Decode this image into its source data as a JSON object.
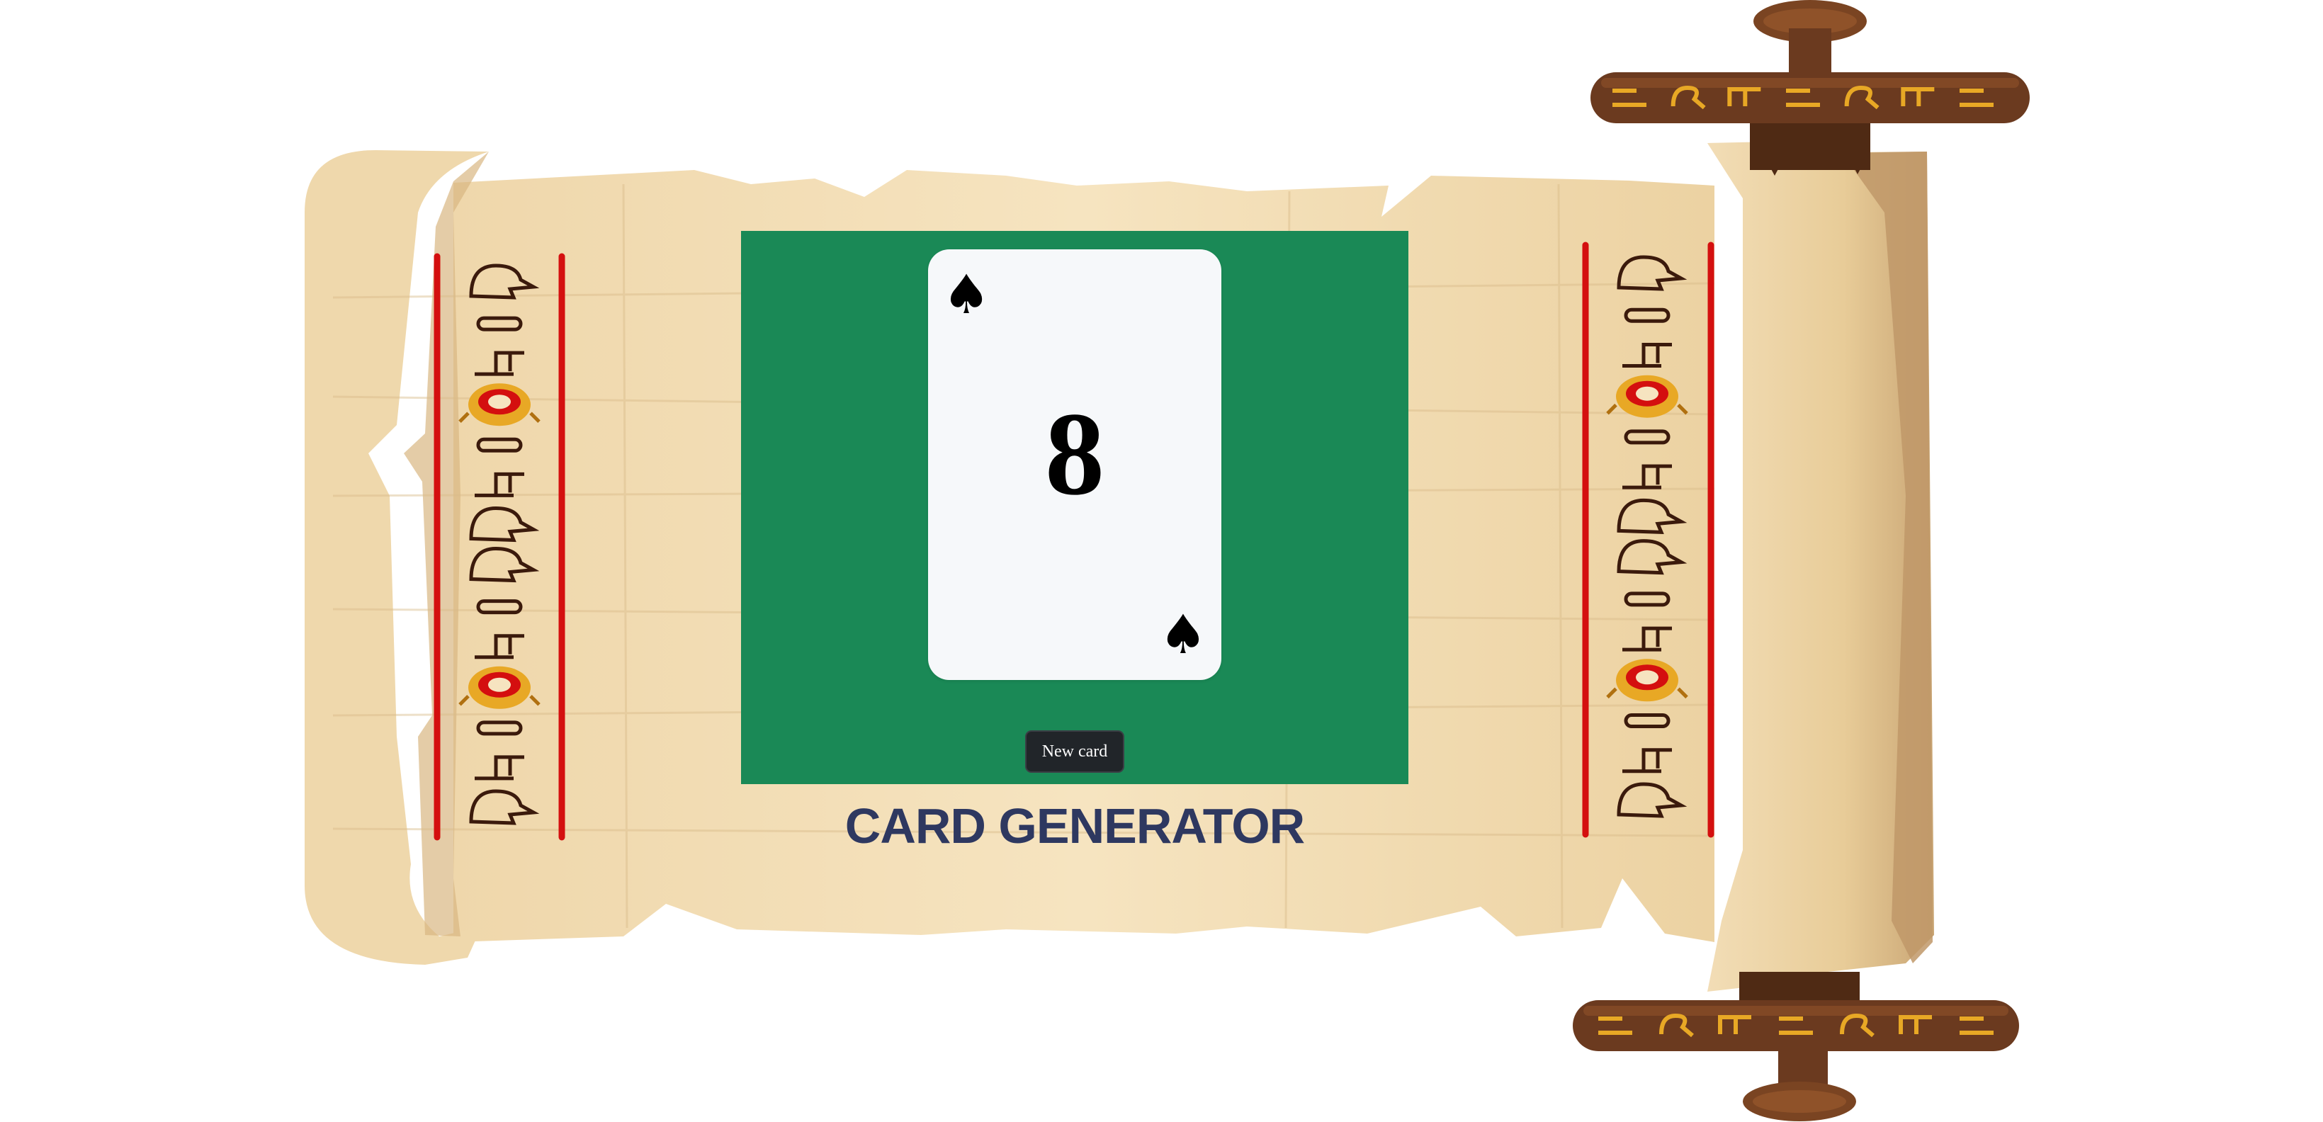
{
  "card": {
    "value": "8",
    "suit_symbol": "♠",
    "suit_name": "spades"
  },
  "controls": {
    "new_card_label": "New card"
  },
  "title": "CARD GENERATOR",
  "icons": {
    "scroll": "papyrus-scroll-icon",
    "roller": "scroll-roller-icon",
    "scarab": "scarab-icon"
  },
  "colors": {
    "table_felt": "#1a8956",
    "card_face": "#f6f8fa",
    "button_bg": "#212529",
    "title": "#2e3860",
    "papyrus": "#f0dcb4",
    "roller_wood": "#6b3a1f",
    "glyph_gold": "#e8a825",
    "border_red": "#d40f0f"
  }
}
